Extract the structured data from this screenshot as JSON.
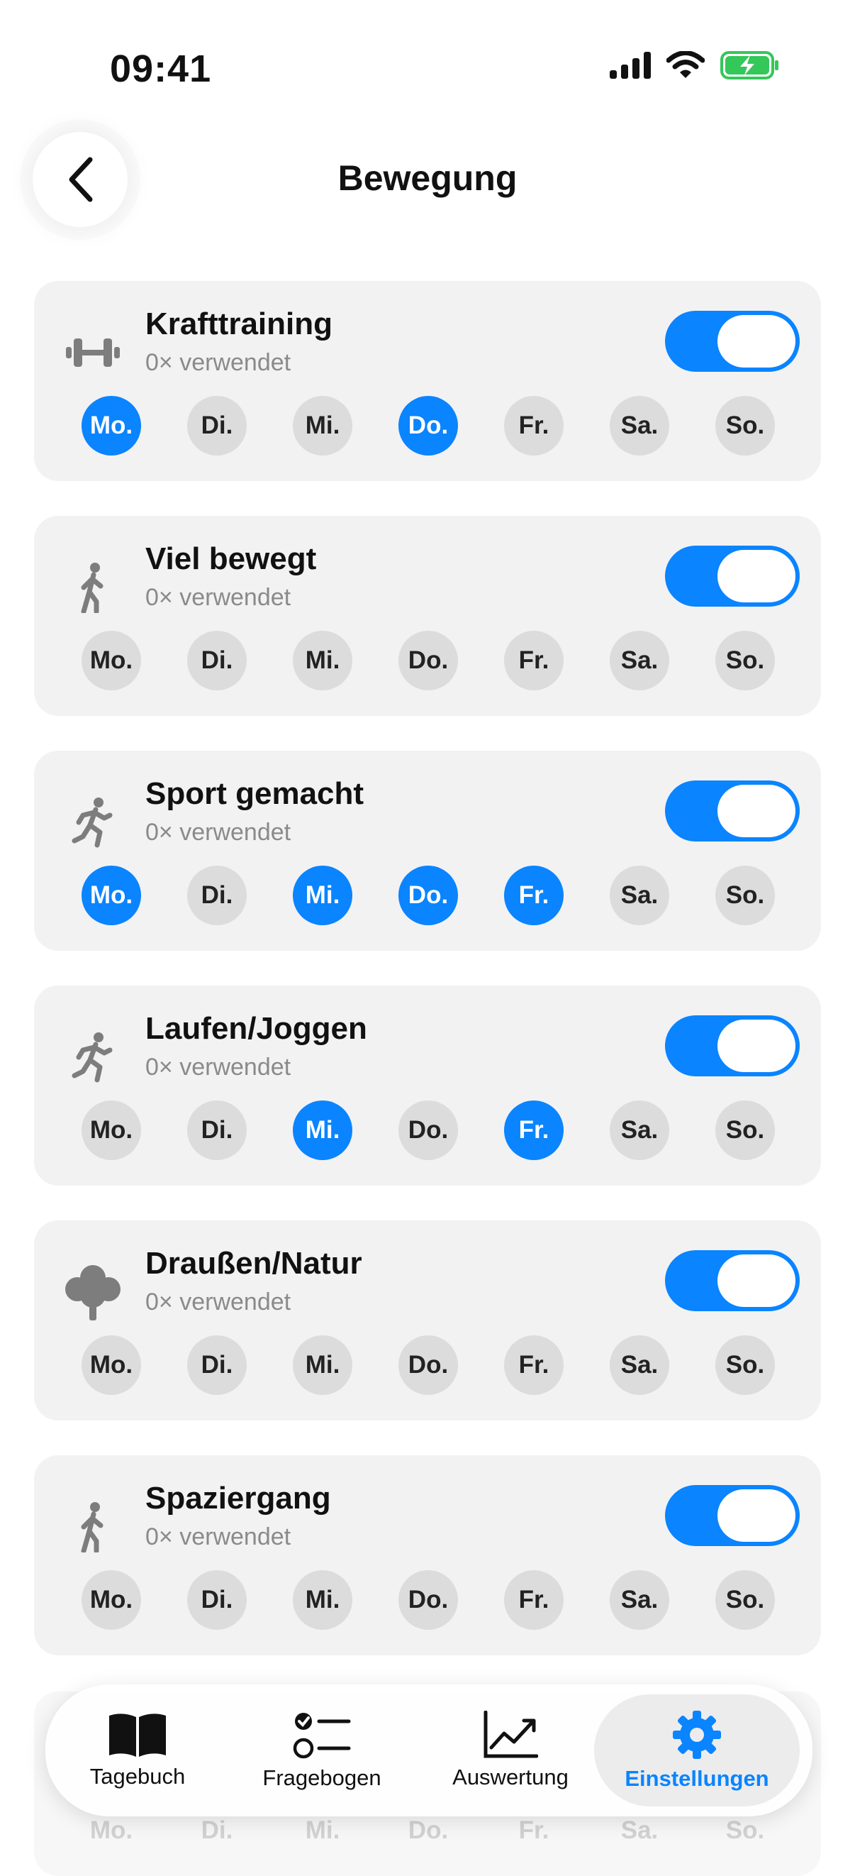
{
  "status": {
    "time": "09:41"
  },
  "header": {
    "title": "Bewegung"
  },
  "items": [
    {
      "name": "Krafttraining",
      "usage": "0× verwendet",
      "icon": "dumbbell-icon",
      "enabled": true,
      "days": [
        {
          "label": "Mo.",
          "on": true
        },
        {
          "label": "Di.",
          "on": false
        },
        {
          "label": "Mi.",
          "on": false
        },
        {
          "label": "Do.",
          "on": true
        },
        {
          "label": "Fr.",
          "on": false
        },
        {
          "label": "Sa.",
          "on": false
        },
        {
          "label": "So.",
          "on": false
        }
      ]
    },
    {
      "name": "Viel bewegt",
      "usage": "0× verwendet",
      "icon": "walking-icon",
      "enabled": true,
      "days": [
        {
          "label": "Mo.",
          "on": false
        },
        {
          "label": "Di.",
          "on": false
        },
        {
          "label": "Mi.",
          "on": false
        },
        {
          "label": "Do.",
          "on": false
        },
        {
          "label": "Fr.",
          "on": false
        },
        {
          "label": "Sa.",
          "on": false
        },
        {
          "label": "So.",
          "on": false
        }
      ]
    },
    {
      "name": "Sport gemacht",
      "usage": "0× verwendet",
      "icon": "running-icon",
      "enabled": true,
      "days": [
        {
          "label": "Mo.",
          "on": true
        },
        {
          "label": "Di.",
          "on": false
        },
        {
          "label": "Mi.",
          "on": true
        },
        {
          "label": "Do.",
          "on": true
        },
        {
          "label": "Fr.",
          "on": true
        },
        {
          "label": "Sa.",
          "on": false
        },
        {
          "label": "So.",
          "on": false
        }
      ]
    },
    {
      "name": "Laufen/Joggen",
      "usage": "0× verwendet",
      "icon": "running-icon",
      "enabled": true,
      "days": [
        {
          "label": "Mo.",
          "on": false
        },
        {
          "label": "Di.",
          "on": false
        },
        {
          "label": "Mi.",
          "on": true
        },
        {
          "label": "Do.",
          "on": false
        },
        {
          "label": "Fr.",
          "on": true
        },
        {
          "label": "Sa.",
          "on": false
        },
        {
          "label": "So.",
          "on": false
        }
      ]
    },
    {
      "name": "Draußen/Natur",
      "usage": "0× verwendet",
      "icon": "tree-icon",
      "enabled": true,
      "days": [
        {
          "label": "Mo.",
          "on": false
        },
        {
          "label": "Di.",
          "on": false
        },
        {
          "label": "Mi.",
          "on": false
        },
        {
          "label": "Do.",
          "on": false
        },
        {
          "label": "Fr.",
          "on": false
        },
        {
          "label": "Sa.",
          "on": false
        },
        {
          "label": "So.",
          "on": false
        }
      ]
    },
    {
      "name": "Spaziergang",
      "usage": "0× verwendet",
      "icon": "walking-icon",
      "enabled": true,
      "days": [
        {
          "label": "Mo.",
          "on": false
        },
        {
          "label": "Di.",
          "on": false
        },
        {
          "label": "Mi.",
          "on": false
        },
        {
          "label": "Do.",
          "on": false
        },
        {
          "label": "Fr.",
          "on": false
        },
        {
          "label": "Sa.",
          "on": false
        },
        {
          "label": "So.",
          "on": false
        }
      ]
    }
  ],
  "partial_item": {
    "days": [
      "Mo.",
      "Di.",
      "Mi.",
      "Do.",
      "Fr.",
      "Sa.",
      "So."
    ]
  },
  "tabbar": {
    "tabs": [
      {
        "label": "Tagebuch",
        "icon": "book-icon",
        "active": false
      },
      {
        "label": "Fragebogen",
        "icon": "checklist-icon",
        "active": false
      },
      {
        "label": "Auswertung",
        "icon": "chart-icon",
        "active": false
      },
      {
        "label": "Einstellungen",
        "icon": "gear-icon",
        "active": true
      }
    ]
  },
  "colors": {
    "accent": "#0a84ff",
    "card": "#f2f2f2",
    "day_off": "#dcdcdc",
    "muted": "#8a8a8a",
    "battery": "#34c759"
  }
}
